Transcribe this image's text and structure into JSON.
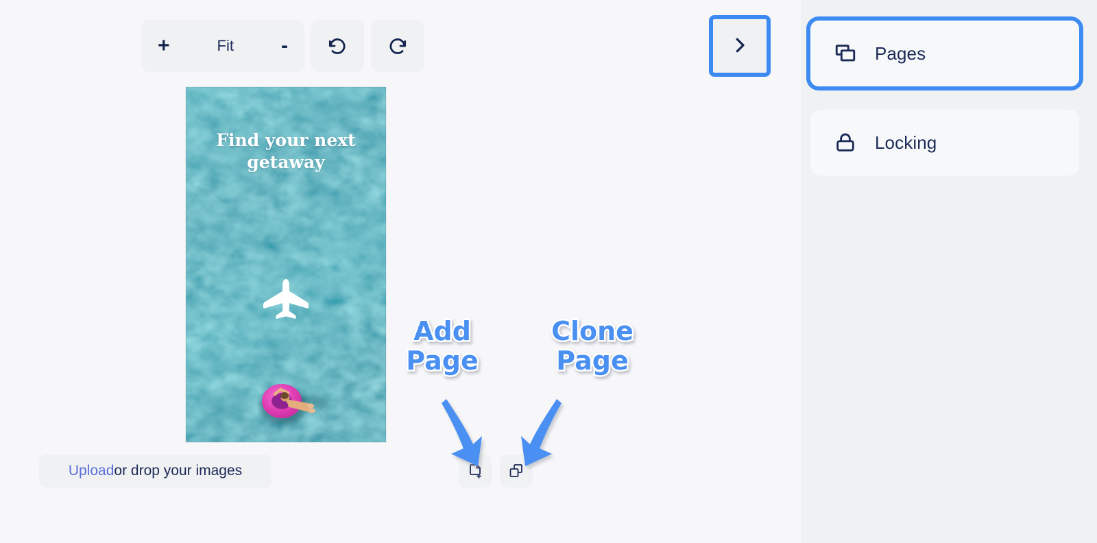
{
  "app": {
    "background_color": "#f7f7f9",
    "sidebar_background_color": "#f0f1f3",
    "accent_color": "#3d8bf2",
    "text_color": "#1b2a56"
  },
  "toolbar": {
    "zoom_in_label": "+",
    "fit_label": "Fit",
    "zoom_out_label": "-",
    "undo_icon": "undo-icon",
    "redo_icon": "redo-icon"
  },
  "collapse_panel": {
    "icon": "chevron-right-icon",
    "highlighted": true
  },
  "sidebar": {
    "items": [
      {
        "label": "Pages",
        "icon": "pages-icon",
        "selected": true
      },
      {
        "label": "Locking",
        "icon": "lock-icon",
        "selected": false
      }
    ]
  },
  "artboard": {
    "headline": "Find your next\ngetaway",
    "water_color": "#2e9aad",
    "plane_icon": "airplane-icon",
    "floatie": "pool-float-person",
    "floatie_color": "#e63fb8"
  },
  "upload": {
    "link_label": "Upload",
    "rest_label": " or drop your images"
  },
  "page_actions": {
    "add": {
      "label": "Add Page",
      "icon": "add-page-icon"
    },
    "clone": {
      "label": "Clone Page",
      "icon": "clone-page-icon"
    }
  },
  "annotations": [
    {
      "text": "Add\nPage",
      "color": "#4a90f2",
      "points_to": "add-page-button"
    },
    {
      "text": "Clone\nPage",
      "color": "#4a90f2",
      "points_to": "clone-page-button"
    }
  ]
}
